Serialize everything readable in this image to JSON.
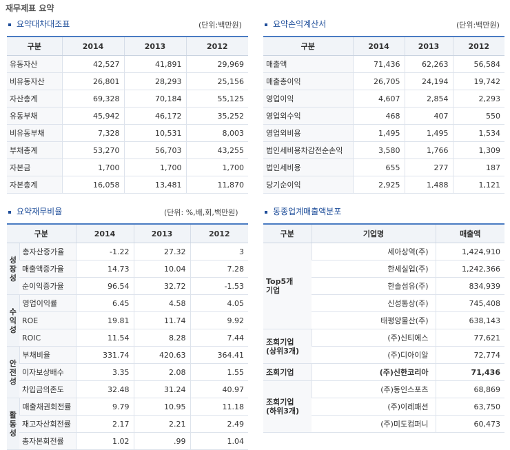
{
  "page_title": "재무제표 요약",
  "bs": {
    "title": "요약대차대조표",
    "unit": "(단위:백만원)",
    "headers": [
      "구분",
      "2014",
      "2013",
      "2012"
    ],
    "rows": [
      {
        "label": "유동자산",
        "v": [
          "42,527",
          "41,891",
          "29,969"
        ]
      },
      {
        "label": "비유동자산",
        "v": [
          "26,801",
          "28,293",
          "25,156"
        ]
      },
      {
        "label": "자산총계",
        "v": [
          "69,328",
          "70,184",
          "55,125"
        ]
      },
      {
        "label": "유동부채",
        "v": [
          "45,942",
          "46,172",
          "35,252"
        ]
      },
      {
        "label": "비유동부채",
        "v": [
          "7,328",
          "10,531",
          "8,003"
        ]
      },
      {
        "label": "부채총계",
        "v": [
          "53,270",
          "56,703",
          "43,255"
        ]
      },
      {
        "label": "자본금",
        "v": [
          "1,700",
          "1,700",
          "1,700"
        ]
      },
      {
        "label": "자본총계",
        "v": [
          "16,058",
          "13,481",
          "11,870"
        ]
      }
    ]
  },
  "is": {
    "title": "요약손익계산서",
    "unit": "(단위:백만원)",
    "headers": [
      "구분",
      "2014",
      "2013",
      "2012"
    ],
    "rows": [
      {
        "label": "매출액",
        "v": [
          "71,436",
          "62,263",
          "56,584"
        ]
      },
      {
        "label": "매출총이익",
        "v": [
          "26,705",
          "24,194",
          "19,742"
        ]
      },
      {
        "label": "영업이익",
        "v": [
          "4,607",
          "2,854",
          "2,293"
        ]
      },
      {
        "label": "영업외수익",
        "v": [
          "468",
          "407",
          "550"
        ]
      },
      {
        "label": "영업외비용",
        "v": [
          "1,495",
          "1,495",
          "1,534"
        ]
      },
      {
        "label": "법인세비용차감전순손익",
        "v": [
          "3,580",
          "1,766",
          "1,309"
        ]
      },
      {
        "label": "법인세비용",
        "v": [
          "655",
          "277",
          "187"
        ]
      },
      {
        "label": "당기순이익",
        "v": [
          "2,925",
          "1,488",
          "1,121"
        ]
      }
    ]
  },
  "ratio": {
    "title": "요약재무비율",
    "unit": "(단위: %,배,회,백만원)",
    "headers": [
      "구분",
      "2014",
      "2013",
      "2012"
    ],
    "groups": [
      {
        "name": "성장성",
        "rows": [
          {
            "label": "총자산증가율",
            "v": [
              "-1.22",
              "27.32",
              "3"
            ]
          },
          {
            "label": "매출액증가율",
            "v": [
              "14.73",
              "10.04",
              "7.28"
            ]
          },
          {
            "label": "순이익증가율",
            "v": [
              "96.54",
              "32.72",
              "-1.53"
            ]
          }
        ]
      },
      {
        "name": "수익성",
        "rows": [
          {
            "label": "영업이익률",
            "v": [
              "6.45",
              "4.58",
              "4.05"
            ]
          },
          {
            "label": "ROE",
            "v": [
              "19.81",
              "11.74",
              "9.92"
            ]
          },
          {
            "label": "ROIC",
            "v": [
              "11.54",
              "8.28",
              "7.44"
            ]
          }
        ]
      },
      {
        "name": "안전성",
        "rows": [
          {
            "label": "부채비율",
            "v": [
              "331.74",
              "420.63",
              "364.41"
            ]
          },
          {
            "label": "이자보상배수",
            "v": [
              "3.35",
              "2.08",
              "1.55"
            ]
          },
          {
            "label": "차입금의존도",
            "v": [
              "32.48",
              "31.24",
              "40.97"
            ]
          }
        ]
      },
      {
        "name": "활동성",
        "rows": [
          {
            "label": "매출채권회전률",
            "v": [
              "9.79",
              "10.95",
              "11.18"
            ]
          },
          {
            "label": "재고자산회전률",
            "v": [
              "2.17",
              "2.21",
              "2.49"
            ]
          },
          {
            "label": "총자본회전률",
            "v": [
              "1.02",
              ".99",
              "1.04"
            ]
          }
        ]
      }
    ]
  },
  "peer": {
    "title": "동종업계매출액분포",
    "headers": [
      "구분",
      "기업명",
      "매출액"
    ],
    "groups": [
      {
        "name": "Top5개\n기업",
        "rows": [
          {
            "company": "세아상역(주)",
            "sales": "1,424,910"
          },
          {
            "company": "한세실업(주)",
            "sales": "1,242,366"
          },
          {
            "company": "한솔섬유(주)",
            "sales": "834,939"
          },
          {
            "company": "신성통상(주)",
            "sales": "745,408"
          },
          {
            "company": "태평양물산(주)",
            "sales": "638,143"
          }
        ]
      },
      {
        "name": "조회기업\n(상위3개)",
        "rows": [
          {
            "company": "(주)신티에스",
            "sales": "77,621"
          },
          {
            "company": "(주)디아이알",
            "sales": "72,774"
          }
        ]
      },
      {
        "name": "조회기업",
        "highlight": true,
        "rows": [
          {
            "company": "(주)신한코리아",
            "sales": "71,436"
          }
        ]
      },
      {
        "name": "조회기업\n(하위3개)",
        "rows": [
          {
            "company": "(주)동인스포츠",
            "sales": "68,869"
          },
          {
            "company": "(주)이레패션",
            "sales": "63,750"
          },
          {
            "company": "(주)미도컴퍼니",
            "sales": "60,473"
          }
        ]
      }
    ]
  }
}
